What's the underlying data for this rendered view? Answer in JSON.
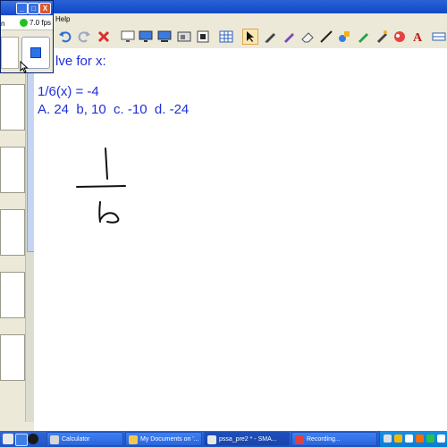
{
  "menu": {
    "help": "Help"
  },
  "recorder": {
    "fps": "7.0 fps",
    "left_label": "n",
    "min": "_",
    "max": "□",
    "close": "X"
  },
  "canvas": {
    "line1": "lve for x:",
    "line2": "1/6(x) = -4",
    "line3": "A. 24  b, 10  c. -10  d. -24"
  },
  "taskbar": {
    "tasks": [
      "Calculator",
      "My Documents on '...",
      "pssa_pre2 * - SMA...",
      "Recording..."
    ]
  },
  "colors": {
    "text_blue": "#1f2fd8",
    "taskbar": "#2a5ccc",
    "accent": "#fbe6b0"
  }
}
